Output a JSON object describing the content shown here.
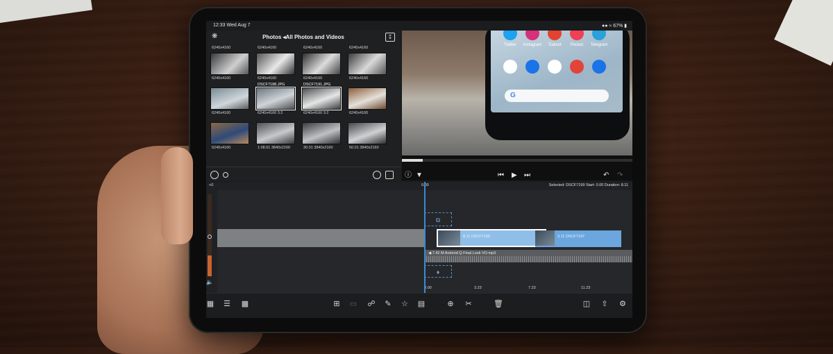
{
  "status": {
    "time": "12:33  Wed Aug 7",
    "battery": "67%"
  },
  "browser": {
    "title": "Photos ◂All Photos and Videos",
    "thumbs": [
      {
        "label": "6240x4160"
      },
      {
        "label": "6240x4160"
      },
      {
        "label": "6240x4160"
      },
      {
        "label": "6240x4160"
      },
      {
        "label": "6240x4160"
      },
      {
        "label": "6240x4160"
      },
      {
        "label": "6240x4160"
      },
      {
        "label": "6240x4160"
      },
      {
        "label": "6240x4160"
      },
      {
        "label": "6240x4160  3:2"
      },
      {
        "label": "6240x4160  3:2"
      },
      {
        "label": "6240x4160"
      },
      {
        "label": "6240x4160"
      },
      {
        "label": "1:08.61  3840x2160"
      },
      {
        "label": "30.01  3840x2160"
      },
      {
        "label": "50.01  3840x2160"
      }
    ],
    "filenames": {
      "f1": "DSCF7188.JPG",
      "f2": "DSCF7191.JPG"
    }
  },
  "preview": {
    "apps": [
      {
        "name": "Twitter",
        "color": "#1da1f2"
      },
      {
        "name": "Instagram",
        "color": "#d6307a"
      },
      {
        "name": "Todoist",
        "color": "#e44332"
      },
      {
        "name": "Pocket",
        "color": "#ef4056"
      },
      {
        "name": "Telegram",
        "color": "#2aa1da"
      }
    ],
    "dock": [
      {
        "name": "phone",
        "color": "#1a73e8"
      },
      {
        "name": "arrow",
        "color": "#1a73e8"
      },
      {
        "name": "play",
        "color": "#ffffff"
      },
      {
        "name": "chrome",
        "color": "#e4433a"
      },
      {
        "name": "camera",
        "color": "#1a73e8"
      }
    ],
    "search_glyph": "G"
  },
  "timeline": {
    "gain": "+0",
    "playhead_time": "0.00",
    "selected_info": "Selected: DSCF7199  Start: 0.00  Duration: 8.11",
    "clip1_label": "8.11  DSCF7199",
    "clip2_label": "3.11  DSCF7197",
    "audio_label": "◀ 7.42 M  Android Q Final Look VO.mp3",
    "ruler": [
      "0.00",
      "3.23",
      "7.23",
      "11.23"
    ]
  },
  "colors": {
    "accent": "#3a8bd8",
    "selected_clip": "#8fbfe8",
    "audio_track": "#5a5c5f"
  }
}
